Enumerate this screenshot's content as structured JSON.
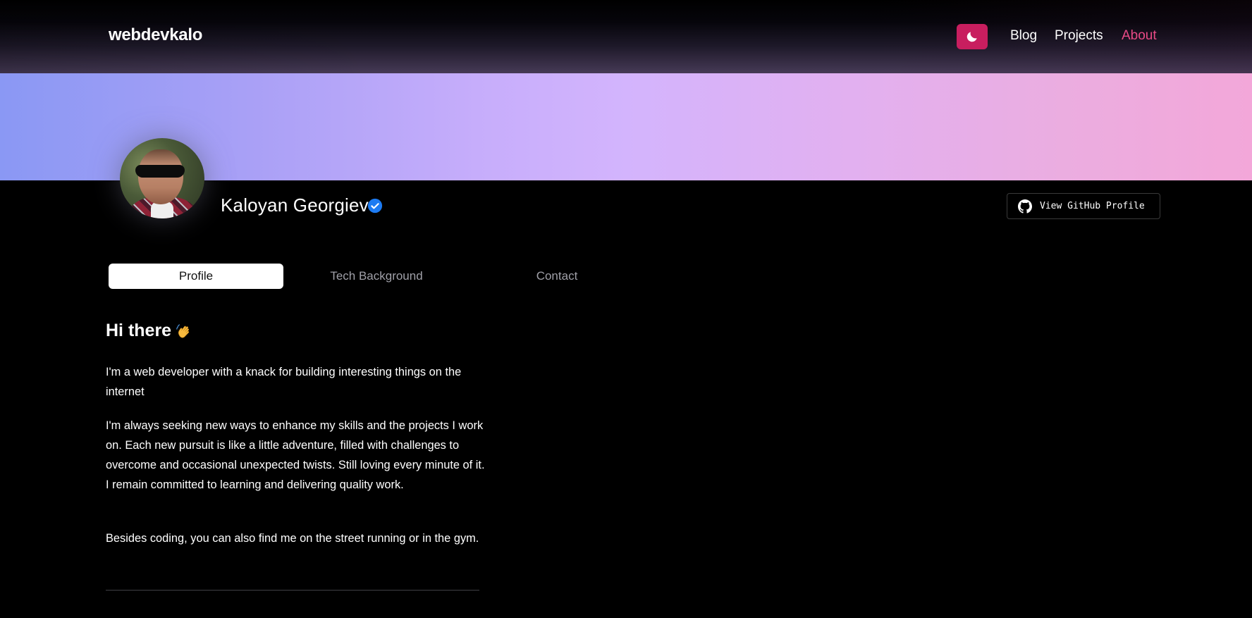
{
  "header": {
    "brand": "webdevkalo",
    "theme_toggle_icon": "moon-icon",
    "nav": {
      "blog": "Blog",
      "projects": "Projects",
      "about": "About"
    },
    "active_nav": "about"
  },
  "profile": {
    "name": "Kaloyan Georgiev",
    "verified_icon": "verified-badge-icon",
    "github_button": "View GitHub Profile",
    "github_icon": "github-icon"
  },
  "tabs": {
    "profile": "Profile",
    "tech": "Tech Background",
    "contact": "Contact",
    "active": "Profile"
  },
  "content": {
    "greeting": "Hi there",
    "greeting_icon": "waving-hand-icon",
    "paragraphs": [
      "I'm a web developer with a knack for building interesting things on the internet",
      "I'm always seeking new ways to enhance my skills and the projects I work on. Each new pursuit is like a little adventure, filled with challenges to overcome and occasional unexpected twists. Still loving every minute of it. I remain committed to learning and delivering quality work.",
      "Besides coding, you can also find me on the street running or in the gym."
    ]
  },
  "colors": {
    "accent": "#c81e5f",
    "active_nav": "#e94a86",
    "verified": "#1d7bf2",
    "background": "#000000",
    "banner_start": "#8a98f4",
    "banner_end": "#f3a7d9"
  }
}
